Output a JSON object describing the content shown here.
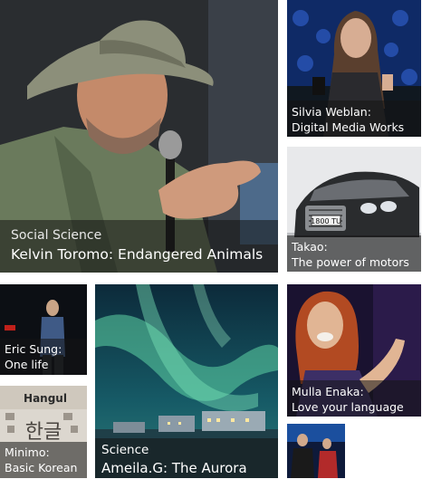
{
  "tiles": {
    "kelvin": {
      "category": "Social Science",
      "title": "Kelvin Toromo: Endangered Animals"
    },
    "silvia": {
      "name": "Silvia Weblan:",
      "talk": "Digital Media Works"
    },
    "takao": {
      "name": "Takao:",
      "talk": "The power of motors",
      "plate": "1800 TU"
    },
    "eric": {
      "name": "Eric Sung:",
      "talk": "One life"
    },
    "aurora": {
      "category": "Science",
      "title": "Ameila.G: The Aurora"
    },
    "mulla": {
      "name": "Mulla Enaka:",
      "talk": "Love your language"
    },
    "minimo": {
      "name": "Minimo:",
      "talk": "Basic Korean",
      "book_title": "Hangul",
      "book_glyphs": "한글"
    },
    "duo": {}
  },
  "colors": {
    "caption_overlay": "#141414",
    "aurora_green": "#5fd6a6",
    "car_silver": "#c9ccd0",
    "stage_blue": "#1b4f9e"
  },
  "icons": [
    "microphone-icon"
  ]
}
